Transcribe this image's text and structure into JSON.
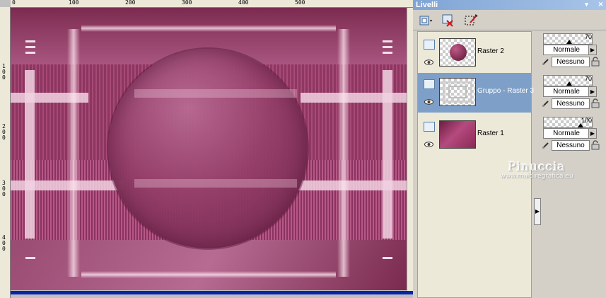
{
  "ruler": {
    "top_labels": [
      "0",
      "100",
      "200",
      "300",
      "400",
      "500"
    ],
    "left_labels": [
      "1\n0\n0",
      "2\n0\n0",
      "3\n0\n0",
      "4\n0\n0"
    ]
  },
  "panel": {
    "title": "Livelli",
    "toolbar": {
      "new_layer_icon": "new-layer-icon",
      "delete_layer_icon": "delete-layer-icon",
      "edit_selection_icon": "edit-selection-icon"
    },
    "layers": [
      {
        "name": "Raster 2",
        "opacity": "70",
        "blend": "Normale",
        "mask": "Nessuno",
        "selected": false
      },
      {
        "name": "Gruppo - Raster 3",
        "opacity": "70",
        "blend": "Normale",
        "mask": "Nessuno",
        "selected": true
      },
      {
        "name": "Raster 1",
        "opacity": "100",
        "blend": "Normale",
        "mask": "Nessuno",
        "selected": false
      }
    ]
  },
  "watermark": {
    "name": "Pinuccia",
    "site": "www.maidiregrafica.eu"
  },
  "colors": {
    "accent": "#7ea0c8",
    "canvas_pink": "#a84a76",
    "selection_blue": "#0a24a8"
  }
}
